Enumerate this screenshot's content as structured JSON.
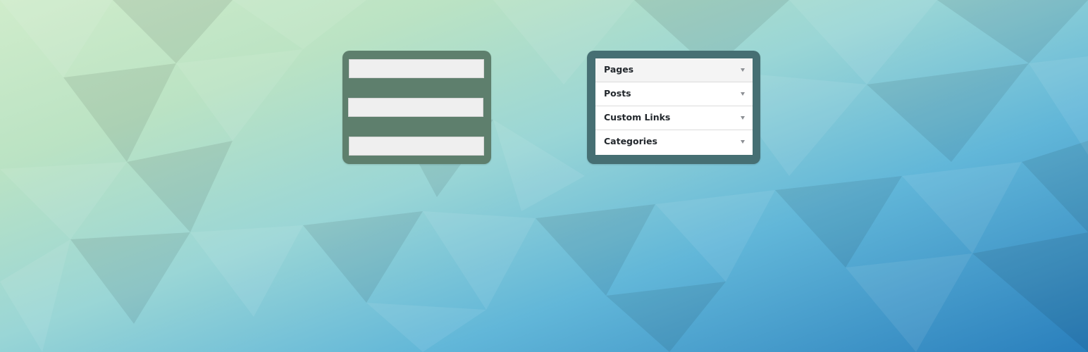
{
  "left_panel": {
    "bars": [
      "",
      "",
      ""
    ]
  },
  "menu_panel": {
    "items": [
      {
        "label": "Pages",
        "icon": "triangle-down-icon",
        "active": true
      },
      {
        "label": "Posts",
        "icon": "triangle-down-icon",
        "active": false
      },
      {
        "label": "Custom Links",
        "icon": "triangle-down-icon",
        "active": false
      },
      {
        "label": "Categories",
        "icon": "triangle-down-icon",
        "active": false
      }
    ]
  },
  "colors": {
    "left_panel_bg": "#5e7f6d",
    "right_panel_bg": "#466f73",
    "bar_bg": "#efefef",
    "active_item_bg": "#f4f4f4",
    "text": "#23282d",
    "arrow": "#8c8f94"
  }
}
